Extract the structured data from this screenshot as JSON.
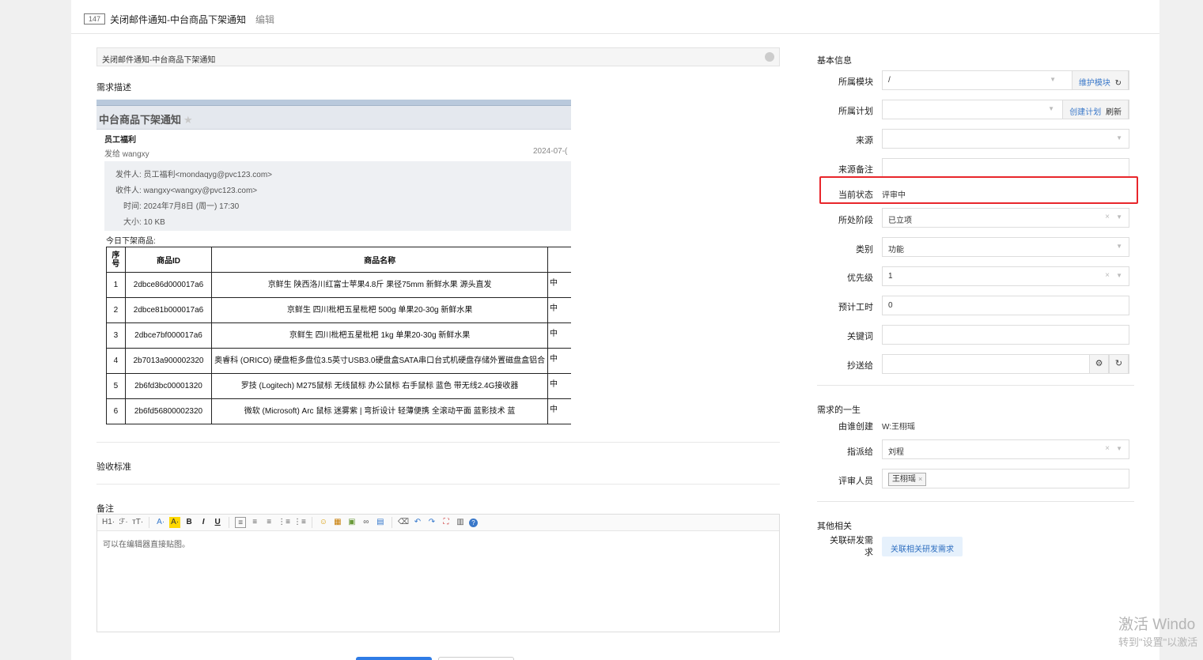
{
  "breadcrumb": {
    "id": "147",
    "title": "关闭邮件通知-中台商品下架通知",
    "separator": "›",
    "current": "编辑"
  },
  "title_field": {
    "value": "关闭邮件通知-中台商品下架通知"
  },
  "labels": {
    "description": "需求描述",
    "acceptance": "验收标准",
    "remarks": "备注"
  },
  "email": {
    "subject": "中台商品下架通知",
    "star": "★",
    "sender_name": "员工福利",
    "sent_to": "发给 wangxy",
    "date": "2024-07-(",
    "meta": {
      "from": "发件人: 员工福利<mondaqyg@pvc123.com>",
      "to": "收件人: wangxy<wangxy@pvc123.com>",
      "time": "时间: 2024年7月8日 (周一) 17:30",
      "size": "大小: 10 KB"
    },
    "intro": "今日下架商品:",
    "table": {
      "headers": {
        "seq": "序号",
        "id": "商品ID",
        "name": "商品名称"
      },
      "rows": [
        {
          "seq": "1",
          "id": "2dbce86d000017a6",
          "name": "京鲜生 陕西洛川红富士苹果4.8斤 果径75mm 新鲜水果 源头直发",
          "more": "中"
        },
        {
          "seq": "2",
          "id": "2dbce81b000017a6",
          "name": "京鲜生 四川枇杷五星枇杷 500g 单果20-30g 新鲜水果",
          "more": "中"
        },
        {
          "seq": "3",
          "id": "2dbce7bf000017a6",
          "name": "京鲜生 四川枇杷五星枇杷 1kg 单果20-30g 新鲜水果",
          "more": "中"
        },
        {
          "seq": "4",
          "id": "2b7013a900002320",
          "name": "奥睿科 (ORICO) 硬盘柜多盘位3.5英寸USB3.0硬盘盒SATA串口台式机硬盘存储外置磁盘盒铝合",
          "more": "中"
        },
        {
          "seq": "5",
          "id": "2b6fd3bc00001320",
          "name": "罗技 (Logitech) M275鼠标 无线鼠标 办公鼠标 右手鼠标 蓝色 带无线2.4G接收器",
          "more": "中"
        },
        {
          "seq": "6",
          "id": "2b6fd56800002320",
          "name": "微软 (Microsoft) Arc 鼠标 迷雾紫 | 弯折设计 轻薄便携 全滚动平面 蓝影技术 蓝",
          "more": "中"
        }
      ]
    }
  },
  "editor": {
    "toolbar": [
      "H1·",
      "ℱ·",
      "ᴛT·",
      "A·",
      "A·",
      "B",
      "I",
      "U",
      "≡",
      "≡",
      "≡",
      "⋮≡",
      "⋮≡",
      "☺",
      "▦",
      "▣",
      "∞",
      "▤",
      "⌫",
      "↶",
      "↷",
      "⛶",
      "▥",
      "?"
    ],
    "placeholder": "可以在编辑器直接贴图。"
  },
  "side": {
    "basic_title": "基本信息",
    "module": {
      "label": "所属模块",
      "value": "/",
      "addon": "维护模块",
      "refresh_icon": "↻"
    },
    "plan": {
      "label": "所属计划",
      "value": "",
      "addon": "创建计划",
      "addon2": "刷新"
    },
    "source": {
      "label": "来源",
      "value": ""
    },
    "source_note": {
      "label": "来源备注",
      "value": ""
    },
    "status": {
      "label": "当前状态",
      "value": "评审中"
    },
    "stage": {
      "label": "所处阶段",
      "value": "已立项"
    },
    "category": {
      "label": "类别",
      "value": "功能"
    },
    "priority": {
      "label": "优先级",
      "value": "1"
    },
    "estimate": {
      "label": "预计工时",
      "value": "0"
    },
    "keywords": {
      "label": "关键词",
      "value": ""
    },
    "cc": {
      "label": "抄送给",
      "value": "",
      "gear_icon": "⚙",
      "refresh_icon": "↻"
    },
    "life_title": "需求的一生",
    "creator": {
      "label": "由谁创建",
      "value": "W:王栩瑶"
    },
    "assigned": {
      "label": "指派给",
      "value": "刘程"
    },
    "reviewer": {
      "label": "评审人员",
      "tag": "王栩瑶",
      "remove": "×"
    },
    "other_title": "其他相关",
    "related": {
      "label_line1": "关联研发需",
      "label_line2": "求",
      "button": "关联相关研发需求"
    },
    "caret": "▼",
    "clear": "×"
  },
  "watermark": {
    "line1": "激活 Windo",
    "line2": "转到\"设置\"以激活"
  },
  "colors": {
    "highlight": "#e8262b",
    "primary": "#2f7ce6",
    "link": "#3a78c9"
  }
}
